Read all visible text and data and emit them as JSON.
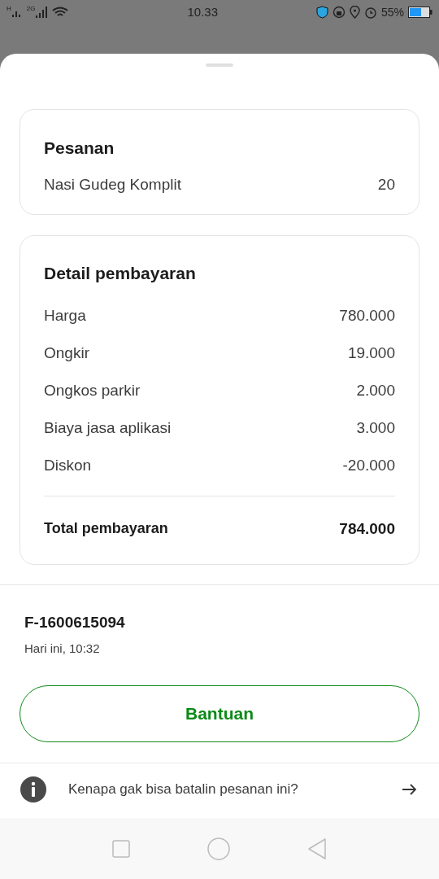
{
  "status_bar": {
    "signal_1_label": "H",
    "signal_2_label": "2G",
    "time": "10.33",
    "battery": "55%"
  },
  "order": {
    "title": "Pesanan",
    "items": [
      {
        "name": "Nasi Gudeg Komplit",
        "quantity": "20"
      }
    ]
  },
  "payment": {
    "title": "Detail pembayaran",
    "rows": [
      {
        "label": "Harga",
        "value": "780.000"
      },
      {
        "label": "Ongkir",
        "value": "19.000"
      },
      {
        "label": "Ongkos parkir",
        "value": "2.000"
      },
      {
        "label": "Biaya jasa aplikasi",
        "value": "3.000"
      },
      {
        "label": "Diskon",
        "value": "-20.000"
      }
    ],
    "total_label": "Total pembayaran",
    "total_value": "784.000"
  },
  "order_id": "F-1600615094",
  "order_time": "Hari ini, 10:32",
  "help_button": "Bantuan",
  "info_link": "Kenapa gak bisa batalin pesanan ini?"
}
